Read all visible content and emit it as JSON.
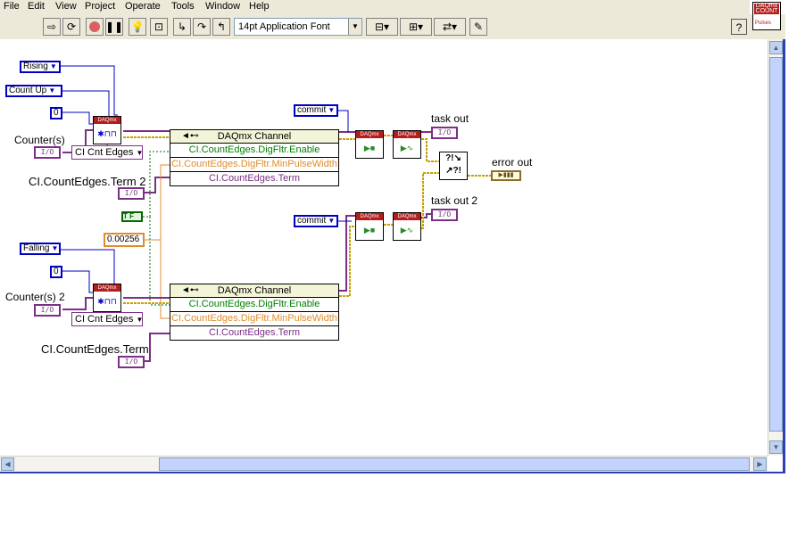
{
  "menu": [
    "File",
    "Edit",
    "View",
    "Project",
    "Operate",
    "Tools",
    "Window",
    "Help"
  ],
  "toolbar": {
    "font": "14pt Application Font",
    "help": "?",
    "icons": [
      "run-arrow-icon",
      "run-continuously-icon",
      "abort-icon",
      "pause-icon",
      "highlight-bulb-icon",
      "retain-wire-values-icon",
      "step-into-icon",
      "step-over-icon",
      "step-out-icon",
      "align-objects-icon",
      "distribute-objects-icon",
      "reorder-icon",
      "cleanup-diagram-icon"
    ]
  },
  "vi_icon": {
    "top": "DAQmx",
    "mid": "COUNT",
    "sub": "Pulses"
  },
  "diagram": {
    "ring_rising": "Rising",
    "ring_count_up": "Count Up",
    "num_0a": "0",
    "num_0b": "0",
    "ring_falling": "Falling",
    "counter1_label": "Counter(s)",
    "counter2_label": "Counter(s) 2",
    "term2_label": "CI.CountEdges.Term 2",
    "term_label": "CI.CountEdges.Term",
    "io": "I/O",
    "enum1": "CI Cnt Edges",
    "enum2": "CI Cnt Edges",
    "bool_const": "T F",
    "dbl_const": "0.00256",
    "commit1": "commit",
    "commit2": "commit",
    "task_out": "task out",
    "task_out2": "task out 2",
    "error_out": "error out",
    "daqmx": "DAQmx",
    "node1": {
      "header": "DAQmx Channel",
      "rows": [
        "CI.CountEdges.DigFltr.Enable",
        "CI.CountEdges.DigFltr.MinPulseWidth",
        "CI.CountEdges.Term"
      ]
    },
    "node2": {
      "header": "DAQmx Channel",
      "rows": [
        "CI.CountEdges.DigFltr.Enable",
        "CI.CountEdges.DigFltr.MinPulseWidth",
        "CI.CountEdges.Term"
      ]
    }
  },
  "colors": {
    "error_wire": "#c8a200",
    "task_wire": "#7c2f86",
    "numeric": "#0000c0",
    "double": "#e08c2c",
    "bool": "#006c00",
    "daqmx_red": "#b51d1d"
  }
}
